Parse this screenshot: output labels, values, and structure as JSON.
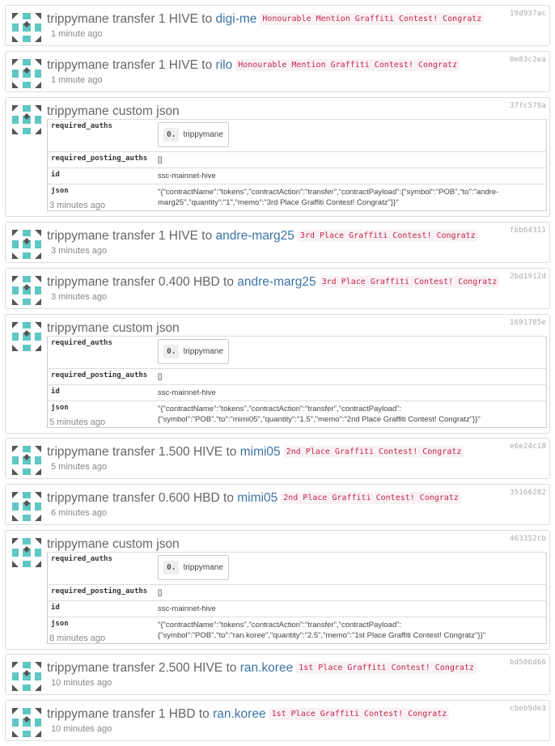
{
  "ops": [
    {
      "kind": "transfer",
      "from": "trippymane",
      "verb": "transfer",
      "amount": "1 HIVE",
      "to_word": "to",
      "to": "digi-me",
      "memo": "Honourable Mention Graffiti Contest! Congratz",
      "time": "1 minute ago",
      "txid": "19d937ac"
    },
    {
      "kind": "transfer",
      "from": "trippymane",
      "verb": "transfer",
      "amount": "1 HIVE",
      "to_word": "to",
      "to": "rilo",
      "memo": "Honourable Mention Graffiti Contest! Congratz",
      "time": "1 minute ago",
      "txid": "0e83c2ea"
    },
    {
      "kind": "json",
      "title": "trippymane custom json",
      "txid": "37fc579a",
      "time": "3 minutes ago",
      "params": {
        "required_auths_key": "required_auths",
        "auth_index": "0.",
        "auth_value": "trippymane",
        "posting_key": "required_posting_auths",
        "posting_value": "[]",
        "id_key": "id",
        "id_value": "ssc-mainnet-hive",
        "json_key": "json",
        "json_value": "\"{\"contractName\":\"tokens\",\"contractAction\":\"transfer\",\"contractPayload\":{\"symbol\":\"POB\",\"to\":\"andre-marg25\",\"quantity\":\"1\",\"memo\":\"3rd Place Graffiti Contest! Congratz\"}}\""
      }
    },
    {
      "kind": "transfer",
      "from": "trippymane",
      "verb": "transfer",
      "amount": "1 HIVE",
      "to_word": "to",
      "to": "andre-marg25",
      "memo": "3rd Place Graffiti Contest! Congratz",
      "time": "3 minutes ago",
      "txid": "fbb64311"
    },
    {
      "kind": "transfer",
      "from": "trippymane",
      "verb": "transfer",
      "amount": "0.400 HBD",
      "to_word": "to",
      "to": "andre-marg25",
      "memo": "3rd Place Graffiti Contest! Congratz",
      "time": "3 minutes ago",
      "txid": "2bd1912d"
    },
    {
      "kind": "json",
      "title": "trippymane custom json",
      "txid": "1691705e",
      "time": "5 minutes ago",
      "params": {
        "required_auths_key": "required_auths",
        "auth_index": "0.",
        "auth_value": "trippymane",
        "posting_key": "required_posting_auths",
        "posting_value": "[]",
        "id_key": "id",
        "id_value": "ssc-mainnet-hive",
        "json_key": "json",
        "json_value": "\"{\"contractName\":\"tokens\",\"contractAction\":\"transfer\",\"contractPayload\": {\"symbol\":\"POB\",\"to\":\"mimi05\",\"quantity\":\"1.5\",\"memo\":\"2nd Place Graffiti Contest! Congratz\"}}\""
      }
    },
    {
      "kind": "transfer",
      "from": "trippymane",
      "verb": "transfer",
      "amount": "1.500 HIVE",
      "to_word": "to",
      "to": "mimi05",
      "memo": "2nd Place Graffiti Contest! Congratz",
      "time": "5 minutes ago",
      "txid": "e6e24c18"
    },
    {
      "kind": "transfer",
      "from": "trippymane",
      "verb": "transfer",
      "amount": "0.600 HBD",
      "to_word": "to",
      "to": "mimi05",
      "memo": "2nd Place Graffiti Contest! Congratz",
      "time": "6 minutes ago",
      "txid": "35166282"
    },
    {
      "kind": "json",
      "title": "trippymane custom json",
      "txid": "463352cb",
      "time": "8 minutes ago",
      "params": {
        "required_auths_key": "required_auths",
        "auth_index": "0.",
        "auth_value": "trippymane",
        "posting_key": "required_posting_auths",
        "posting_value": "[]",
        "id_key": "id",
        "id_value": "ssc-mainnet-hive",
        "json_key": "json",
        "json_value": "\"{\"contractName\":\"tokens\",\"contractAction\":\"transfer\",\"contractPayload\": {\"symbol\":\"POB\",\"to\":\"ran.koree\",\"quantity\":\"2.5\",\"memo\":\"1st Place Graffiti Contest! Congratz\"}}\""
      }
    },
    {
      "kind": "transfer",
      "from": "trippymane",
      "verb": "transfer",
      "amount": "2.500 HIVE",
      "to_word": "to",
      "to": "ran.koree",
      "memo": "1st Place Graffiti Contest! Congratz",
      "time": "10 minutes ago",
      "txid": "bd506d66"
    },
    {
      "kind": "transfer",
      "from": "trippymane",
      "verb": "transfer",
      "amount": "1 HBD",
      "to_word": "to",
      "to": "ran.koree",
      "memo": "1st Place Graffiti Contest! Congratz",
      "time": "10 minutes ago",
      "txid": "cbeb9de3"
    }
  ],
  "colors": {
    "avatar_teal": "#5fc7c4",
    "avatar_dark": "#555555",
    "link": "#3d74a6",
    "memo_text": "#c7254e",
    "memo_bg": "#f9f2f4"
  },
  "icons": {
    "avatar": "identicon-avatar"
  }
}
